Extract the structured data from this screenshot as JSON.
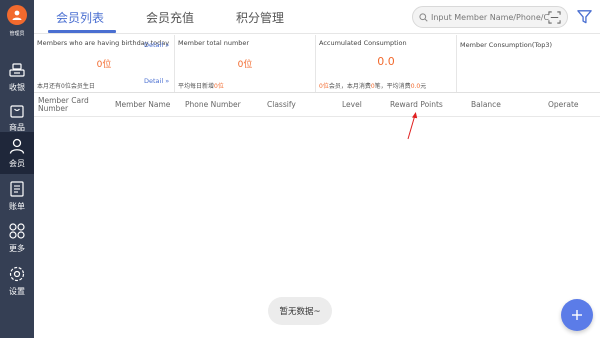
{
  "sidebar": {
    "admin_label": "管理员",
    "items": [
      {
        "label": "收银",
        "icon": "cashier-icon"
      },
      {
        "label": "商品",
        "icon": "bag-icon"
      },
      {
        "label": "会员",
        "icon": "user-icon"
      },
      {
        "label": "账单",
        "icon": "receipt-icon"
      },
      {
        "label": "更多",
        "icon": "grid-icon"
      },
      {
        "label": "设置",
        "icon": "settings-icon"
      }
    ],
    "active_index": 2
  },
  "tabs": [
    {
      "label": "会员列表",
      "active": true
    },
    {
      "label": "会员充值",
      "active": false
    },
    {
      "label": "积分管理",
      "active": false
    }
  ],
  "search": {
    "placeholder": "Input Member Name/Phone/Car"
  },
  "cards": {
    "birthday": {
      "title": "Members who are having birthday today",
      "value": "0位",
      "foot": "本月还有0位会员生日",
      "detail_top": "Detail",
      "detail_bottom": "Detail"
    },
    "total": {
      "title": "Member total number",
      "value": "0位",
      "foot_prefix": "平均每日新增",
      "foot_value": "0位"
    },
    "consumption": {
      "title": "Accumulated Consumption",
      "value": "0.0",
      "foot_a_value": "0位",
      "foot_a_text": "会员，本月消费",
      "foot_b_value": "0",
      "foot_b_text": "笔，平均消费",
      "foot_c_value": "0.0",
      "foot_c_text": "元"
    },
    "top3": {
      "title": "Member Consumption(Top3)"
    }
  },
  "table": {
    "headers": [
      "Member Card Number",
      "Member Name",
      "Phone Number",
      "Classify",
      "Level",
      "Reward Points",
      "Balance",
      "Operate"
    ]
  },
  "empty_text": "暂无数据~",
  "colors": {
    "sidebar": "#353f54",
    "sidebar_active": "#1f273a",
    "accent": "#4a6fd1",
    "orange": "#f26a2e",
    "fab": "#5b7ce8",
    "annotation_arrow": "#e02020"
  }
}
